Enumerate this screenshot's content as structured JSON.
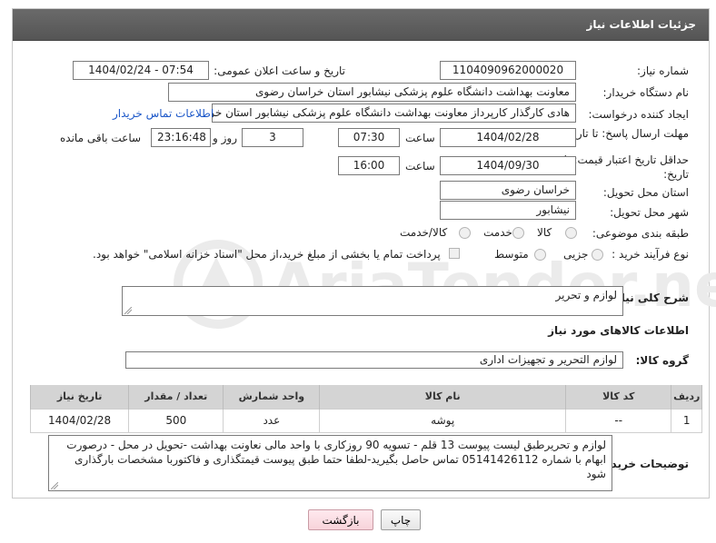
{
  "panel": {
    "title": "جزئیات اطلاعات نیاز"
  },
  "fields": {
    "need_number": {
      "label": "شماره نیاز:",
      "value": "1104090962000020"
    },
    "announce_datetime": {
      "label": "تاریخ و ساعت اعلان عمومی:",
      "value": "1404/02/24 - 07:54"
    },
    "buyer_org": {
      "label": "نام دستگاه خریدار:",
      "value": "معاونت بهداشت دانشگاه علوم پزشکی نیشابور استان خراسان رضوی"
    },
    "requester": {
      "label": "ایجاد کننده درخواست:",
      "value": "هادی کارگذار کارپرداز معاونت بهداشت دانشگاه علوم پزشکی نیشابور استان خر",
      "contact_link": "اطلاعات تماس خریدار"
    },
    "reply_deadline": {
      "label": "مهلت ارسال پاسخ: تا تاریخ:",
      "date": "1404/02/28",
      "time_label": "ساعت",
      "time": "07:30",
      "days": "3",
      "days_label": "روز و",
      "remaining": "23:16:48",
      "remaining_label": "ساعت باقی مانده"
    },
    "price_validity": {
      "label": "حداقل تاریخ اعتبار قیمت: تا تاریخ:",
      "date": "1404/09/30",
      "time_label": "ساعت",
      "time": "16:00"
    },
    "delivery_province": {
      "label": "استان محل تحویل:",
      "value": "خراسان رضوی"
    },
    "delivery_city": {
      "label": "شهر محل تحویل:",
      "value": "نیشابور"
    },
    "category": {
      "label": "طبقه بندی موضوعی:",
      "options": [
        "کالا",
        "خدمت",
        "کالا/خدمت"
      ]
    },
    "purchase_process": {
      "label": "نوع فرآیند خرید :",
      "options": [
        "جزیی",
        "متوسط"
      ],
      "payment_note": "پرداخت تمام یا بخشی از مبلغ خرید،از محل \"اسناد خزانه اسلامی\" خواهد بود."
    },
    "description": {
      "label": "شرح کلی نیاز:",
      "value": "لوازم و تحریر"
    }
  },
  "goods": {
    "section_title": "اطلاعات کالاهای مورد نیاز",
    "group_label": "گروه کالا:",
    "group_value": "لوازم التحریر و تجهیزات اداری",
    "columns": [
      "ردیف",
      "کد کالا",
      "نام کالا",
      "واحد شمارش",
      "تعداد / مقدار",
      "تاریخ نیاز"
    ],
    "rows": [
      {
        "row": "1",
        "code": "--",
        "name": "پوشه",
        "unit": "عدد",
        "qty": "500",
        "date": "1404/02/28"
      }
    ]
  },
  "buyer_notes": {
    "label": "توضیحات خریدار:",
    "value": "لوازم و تحریرطبق لیست پیوست 13 قلم - تسویه 90 روزکاری با واحد مالی نعاونت بهداشت -تحویل در محل - درصورت ابهام با شماره 05141426112 تماس حاصل بگیرید-لطفا حتما طبق پیوست قیمتگذاری و فاکتوربا مشخصات بارگذاری شود"
  },
  "buttons": {
    "print": "چاپ",
    "back": "بازگشت"
  },
  "watermark": {
    "text": "AriaTender.net"
  },
  "colors": {
    "header_bg": "#5e5e5e",
    "link": "#1a56c8",
    "back_button": "#f7d3da",
    "watermark": "#e9e9e9"
  }
}
